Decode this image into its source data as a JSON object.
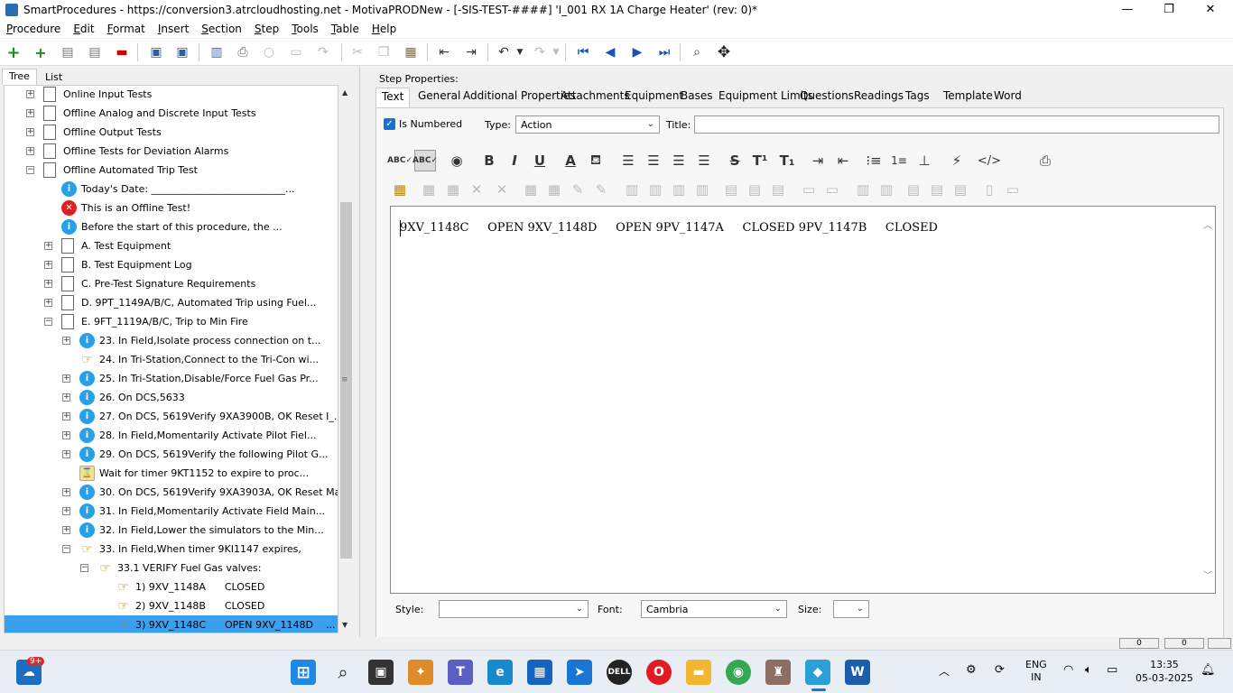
{
  "window": {
    "title": "SmartProcedures - https://conversion3.atrcloudhosting.net - MotivaPRODNew - [-SIS-TEST-####] 'I_001 RX 1A Charge Heater' (rev: 0)*",
    "minimize": "—",
    "maximize": "❐",
    "close": "✕"
  },
  "menu": [
    "Procedure",
    "Edit",
    "Format",
    "Insert",
    "Section",
    "Step",
    "Tools",
    "Table",
    "Help"
  ],
  "left_tabs": {
    "tree": "Tree",
    "list": "List"
  },
  "tree": [
    {
      "label": "Online Input Tests",
      "icon": "doc",
      "level": 0,
      "exp": "+"
    },
    {
      "label": "Offline Analog and Discrete Input Tests",
      "icon": "doc",
      "level": 0,
      "exp": "+"
    },
    {
      "label": "Offline Output Tests",
      "icon": "doc",
      "level": 0,
      "exp": "+"
    },
    {
      "label": "Offline Tests for Deviation Alarms",
      "icon": "doc",
      "level": 0,
      "exp": "+"
    },
    {
      "label": "Offline Automated Trip Test",
      "icon": "doc",
      "level": 0,
      "exp": "−"
    },
    {
      "label": "Today's Date: ___________________________...",
      "icon": "info",
      "level": 1,
      "exp": ""
    },
    {
      "label": "This is an Offline Test!",
      "icon": "err",
      "level": 1,
      "exp": ""
    },
    {
      "label": "Before the start of this procedure, the ...",
      "icon": "info",
      "level": 1,
      "exp": ""
    },
    {
      "label": "A. Test Equipment",
      "icon": "doc",
      "level": 1,
      "exp": "+"
    },
    {
      "label": "B. Test Equipment Log",
      "icon": "doc",
      "level": 1,
      "exp": "+"
    },
    {
      "label": "C. Pre-Test Signature Requirements",
      "icon": "doc",
      "level": 1,
      "exp": "+"
    },
    {
      "label": "D. 9PT_1149A/B/C, Automated Trip using Fuel...",
      "icon": "doc",
      "level": 1,
      "exp": "+"
    },
    {
      "label": "E. 9FT_1119A/B/C, Trip to Min Fire",
      "icon": "doc",
      "level": 1,
      "exp": "−"
    },
    {
      "label": "23. In Field,Isolate process connection on t...",
      "icon": "info",
      "level": 2,
      "exp": "+"
    },
    {
      "label": "24. In Tri-Station,Connect to the Tri-Con wi...",
      "icon": "hand",
      "level": 2,
      "exp": ""
    },
    {
      "label": "25. In Tri-Station,Disable/Force Fuel Gas Pr...",
      "icon": "info",
      "level": 2,
      "exp": "+"
    },
    {
      "label": "26. On DCS,5633",
      "icon": "info",
      "level": 2,
      "exp": "+"
    },
    {
      "label": "27. On DCS, 5619Verify 9XA3900B, OK Reset I_...",
      "icon": "info",
      "level": 2,
      "exp": "+"
    },
    {
      "label": "28. In Field,Momentarily Activate Pilot Fiel...",
      "icon": "info",
      "level": 2,
      "exp": "+"
    },
    {
      "label": "29. On DCS, 5619Verify the following Pilot G...",
      "icon": "info",
      "level": 2,
      "exp": "+"
    },
    {
      "label": "Wait for timer 9KT1152 to expire to proc...",
      "icon": "timer",
      "level": 2,
      "exp": ""
    },
    {
      "label": "30. On DCS, 5619Verify 9XA3903A, OK Reset Ma...",
      "icon": "info",
      "level": 2,
      "exp": "+"
    },
    {
      "label": "31. In Field,Momentarily Activate Field Main...",
      "icon": "info",
      "level": 2,
      "exp": "+"
    },
    {
      "label": "32. In Field,Lower the simulators to the Min...",
      "icon": "info",
      "level": 2,
      "exp": "+"
    },
    {
      "label": "33. In Field,When timer 9KI1147 expires,",
      "icon": "hand",
      "level": 2,
      "exp": "−"
    },
    {
      "label": "33.1 VERIFY Fuel Gas valves:",
      "icon": "hand",
      "level": 3,
      "exp": "−"
    },
    {
      "label": "1) 9XV_1148A      CLOSED",
      "icon": "hand",
      "level": 4,
      "exp": ""
    },
    {
      "label": "2) 9XV_1148B      CLOSED",
      "icon": "hand",
      "level": 4,
      "exp": ""
    },
    {
      "label": "3) 9XV_1148C      OPEN 9XV_1148D    ...",
      "icon": "hand",
      "level": 4,
      "exp": "",
      "selected": true
    }
  ],
  "step_properties": {
    "heading": "Step Properties:",
    "tabs": [
      "Text",
      "General",
      "Additional Properties",
      "Attachments",
      "Equipment",
      "Bases",
      "Equipment Limits",
      "Questions",
      "Readings",
      "Tags",
      "Template",
      "Word"
    ],
    "is_numbered_label": "Is Numbered",
    "is_numbered": true,
    "type_label": "Type:",
    "type_value": "Action",
    "title_label": "Title:",
    "title_value": ""
  },
  "format_icons": {
    "bold": "B",
    "italic": "I",
    "underline": "U",
    "strike": "S",
    "superscript": "T¹",
    "subscript": "T₁",
    "font_color": "A",
    "code": "</>"
  },
  "editor": {
    "text": "9XV_1148C     OPEN 9XV_1148D     OPEN 9PV_1147A     CLOSED 9PV_1147B     CLOSED"
  },
  "footer": {
    "style_label": "Style:",
    "style_value": "",
    "font_label": "Font:",
    "font_value": "Cambria",
    "size_label": "Size:",
    "size_value": ""
  },
  "status": {
    "left": "0",
    "right": "0"
  },
  "taskbar": {
    "notification_badge": "9+",
    "lang_line1": "ENG",
    "lang_line2": "IN",
    "time": "13:35",
    "date": "05-03-2025"
  },
  "colors": {
    "selection": "#3b9ff0",
    "info_icon": "#28a0e8",
    "error_icon": "#e02020",
    "nav_blue": "#1d4fb4"
  }
}
